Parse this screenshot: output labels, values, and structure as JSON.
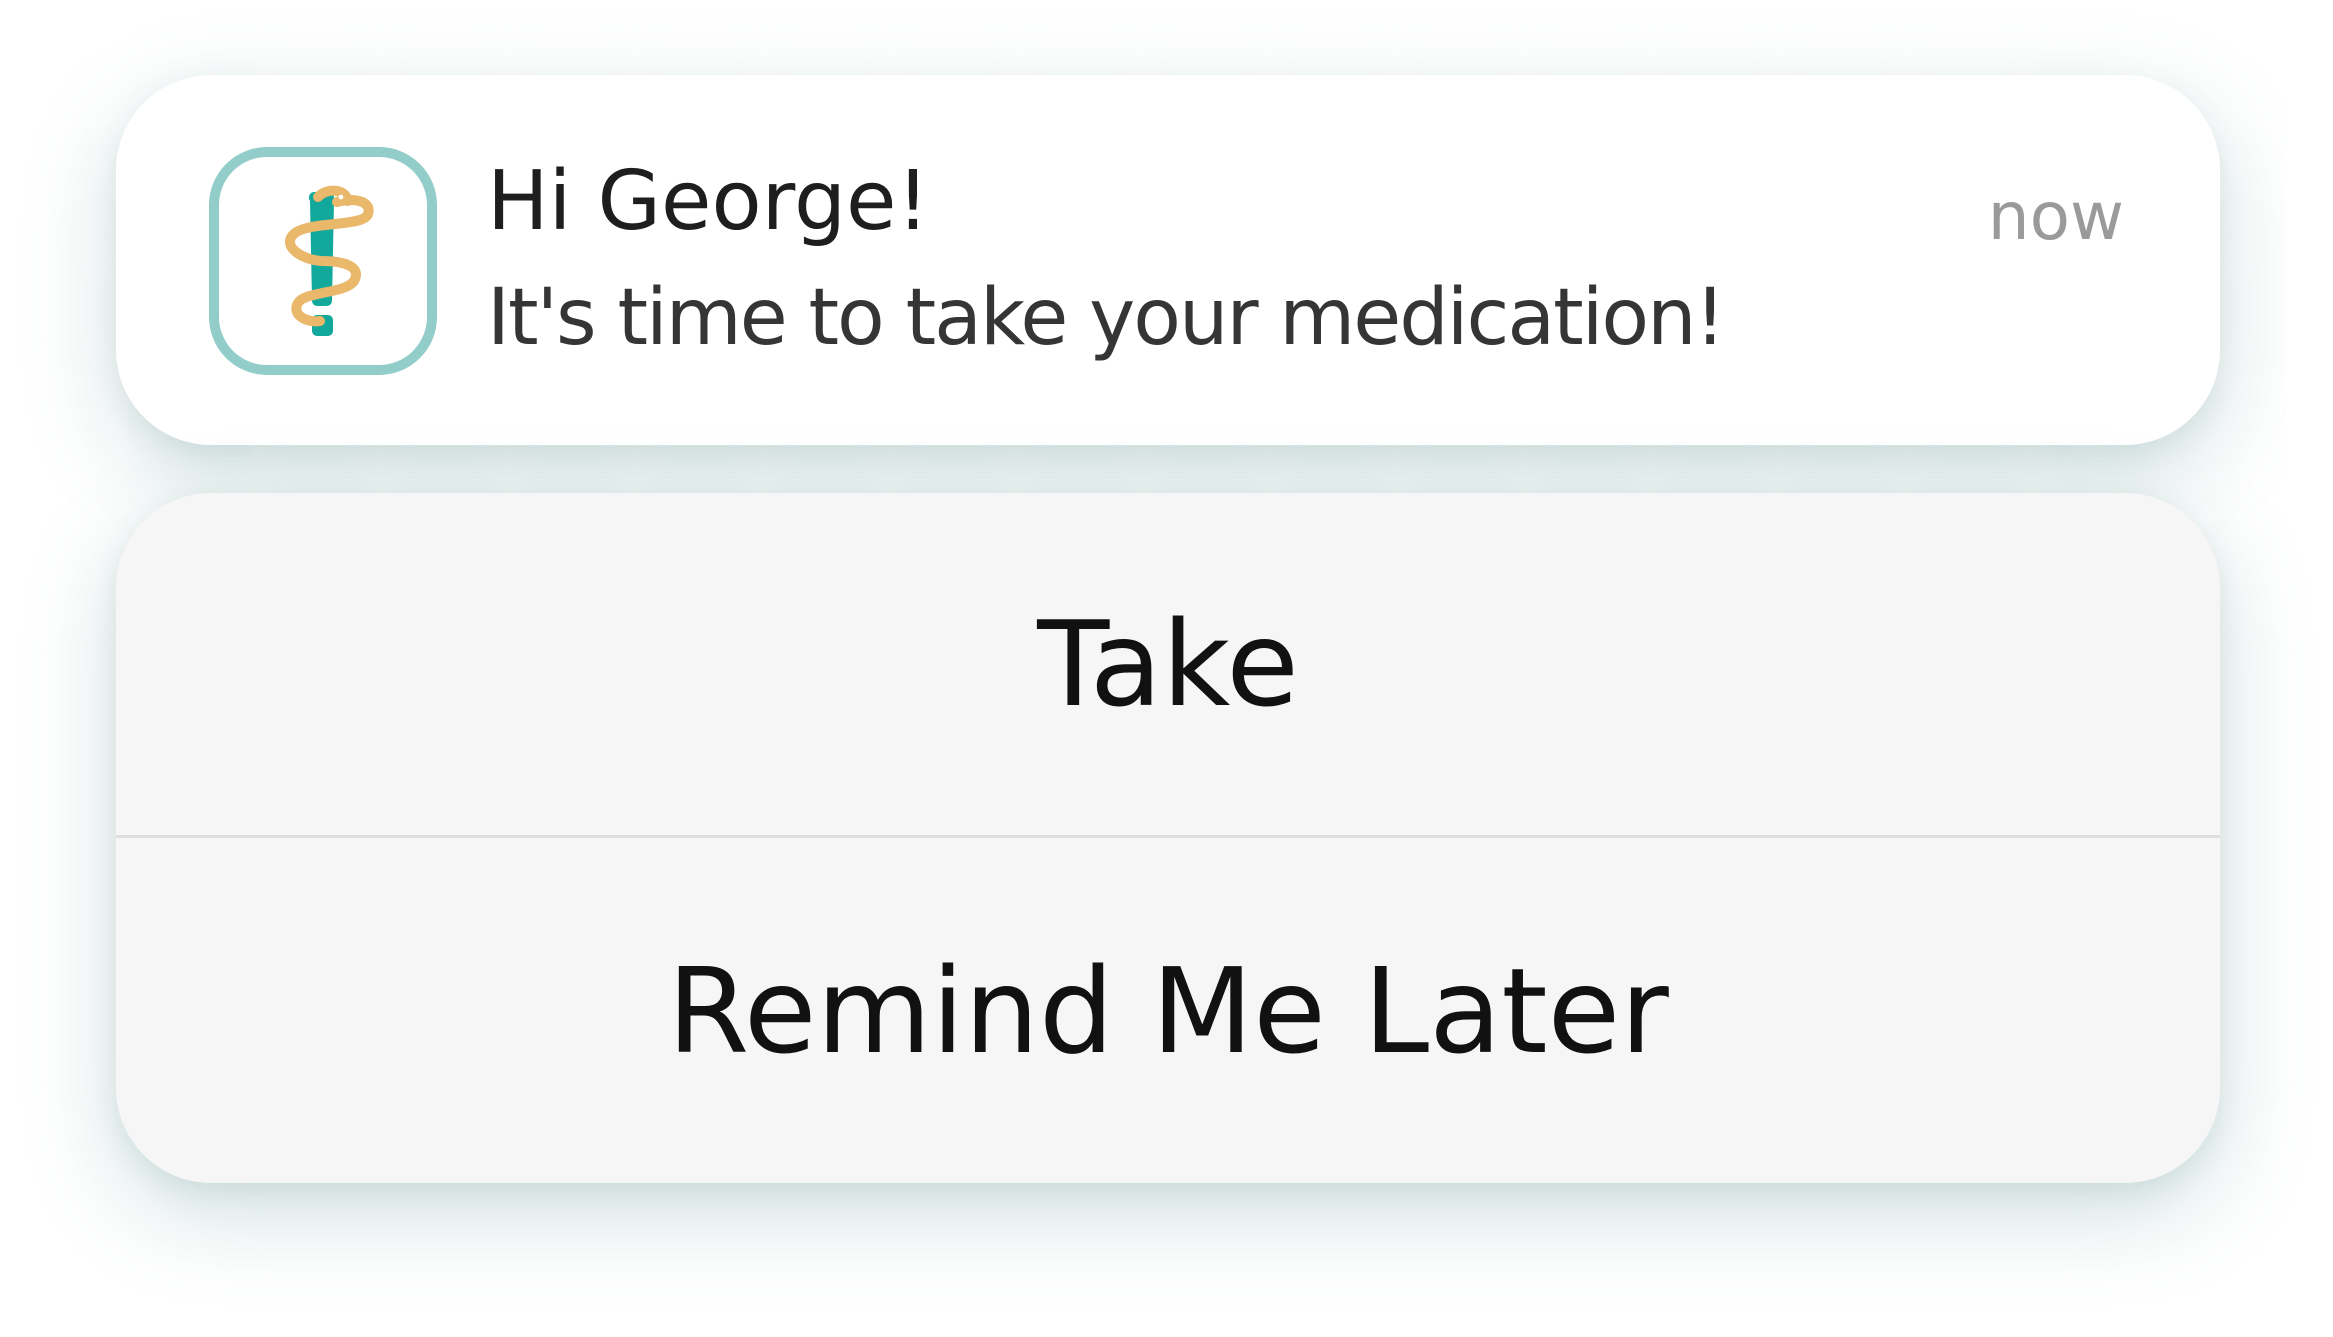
{
  "notification": {
    "app_icon": "staff-of-asclepius-exclamation-icon",
    "title": "Hi George!",
    "body": "It's time to take your medication!",
    "time": "now"
  },
  "actions": {
    "take_label": "Take",
    "remind_label": "Remind Me Later"
  },
  "colors": {
    "icon_border": "#93cdc9",
    "icon_staff": "#12a89c",
    "icon_snake": "#e9b86b",
    "action_background": "#f6f6f6",
    "time_text": "#9a9a9a"
  }
}
